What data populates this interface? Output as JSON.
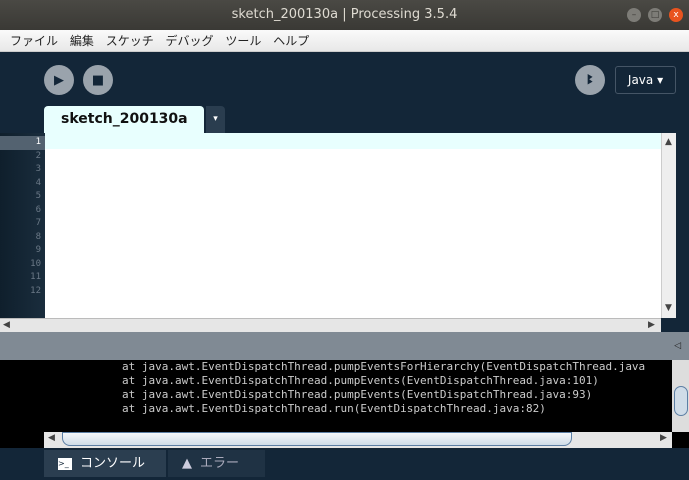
{
  "window": {
    "title": "sketch_200130a | Processing 3.5.4"
  },
  "menu": [
    "ファイル",
    "編集",
    "スケッチ",
    "デバッグ",
    "ツール",
    "ヘルプ"
  ],
  "toolbar": {
    "mode": "Java ▾"
  },
  "tab": {
    "name": "sketch_200130a",
    "menu": "▾"
  },
  "editor": {
    "line_numbers": [
      "1",
      "2",
      "3",
      "4",
      "5",
      "6",
      "7",
      "8",
      "9",
      "10",
      "11",
      "12"
    ]
  },
  "console": {
    "lines": [
      "at java.awt.EventDispatchThread.pumpEventsForHierarchy(EventDispatchThread.java",
      "at java.awt.EventDispatchThread.pumpEvents(EventDispatchThread.java:101)",
      "at java.awt.EventDispatchThread.pumpEvents(EventDispatchThread.java:93)",
      "at java.awt.EventDispatchThread.run(EventDispatchThread.java:82)"
    ]
  },
  "footer": {
    "console": "コンソール",
    "errors": "エラー"
  }
}
